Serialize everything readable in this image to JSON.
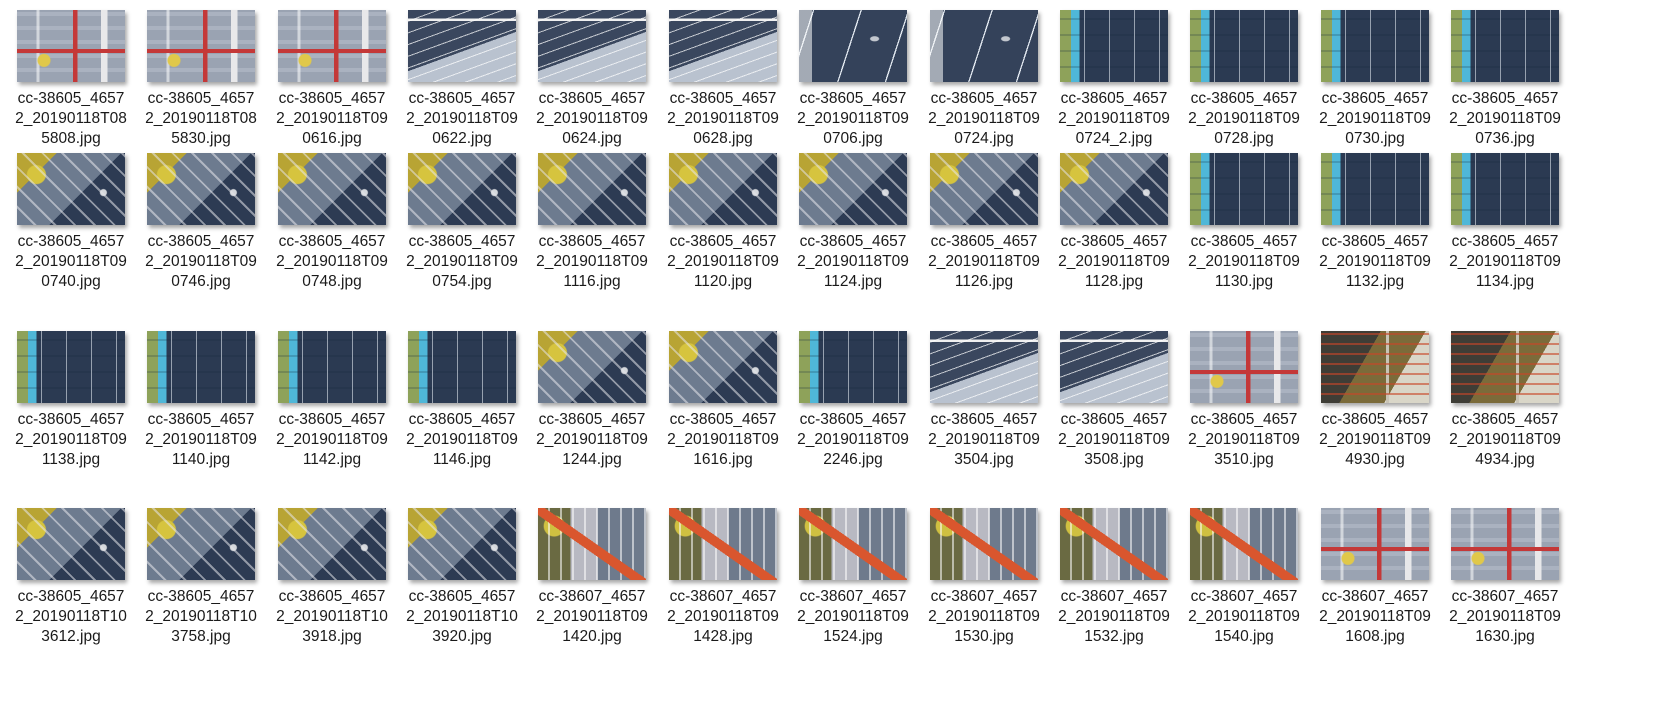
{
  "window": {
    "title": ""
  },
  "files": [
    {
      "name": "cc-38605_46572_20190118T085808.jpg",
      "line1": "cc-38605_4657",
      "line2": "2_20190118T08",
      "line3": "5808.jpg",
      "scene": "site",
      "thumb": "aerial-site-thumbnail"
    },
    {
      "name": "cc-38605_46572_20190118T085830.jpg",
      "line1": "cc-38605_4657",
      "line2": "2_20190118T08",
      "line3": "5830.jpg",
      "scene": "site",
      "thumb": "aerial-site-thumbnail"
    },
    {
      "name": "cc-38605_46572_20190118T090616.jpg",
      "line1": "cc-38605_4657",
      "line2": "2_20190118T09",
      "line3": "0616.jpg",
      "scene": "site",
      "thumb": "aerial-site-thumbnail"
    },
    {
      "name": "cc-38605_46572_20190118T090622.jpg",
      "line1": "cc-38605_4657",
      "line2": "2_20190118T09",
      "line3": "0622.jpg",
      "scene": "viaduct",
      "thumb": "aerial-viaduct-thumbnail"
    },
    {
      "name": "cc-38605_46572_20190118T090624.jpg",
      "line1": "cc-38605_4657",
      "line2": "2_20190118T09",
      "line3": "0624.jpg",
      "scene": "viaduct",
      "thumb": "aerial-viaduct-thumbnail"
    },
    {
      "name": "cc-38605_46572_20190118T090628.jpg",
      "line1": "cc-38605_4657",
      "line2": "2_20190118T09",
      "line3": "0628.jpg",
      "scene": "viaduct",
      "thumb": "aerial-viaduct-thumbnail"
    },
    {
      "name": "cc-38605_46572_20190118T090706.jpg",
      "line1": "cc-38605_4657",
      "line2": "2_20190118T09",
      "line3": "0706.jpg",
      "scene": "road",
      "thumb": "aerial-road-thumbnail"
    },
    {
      "name": "cc-38605_46572_20190118T090724.jpg",
      "line1": "cc-38605_4657",
      "line2": "2_20190118T09",
      "line3": "0724.jpg",
      "scene": "road",
      "thumb": "aerial-road-thumbnail"
    },
    {
      "name": "cc-38605_46572_20190118T090724_2.jpg",
      "line1": "cc-38605_4657",
      "line2": "2_20190118T09",
      "line3": "0724_2.jpg",
      "scene": "bus",
      "thumb": "aerial-road-thumbnail"
    },
    {
      "name": "cc-38605_46572_20190118T090728.jpg",
      "line1": "cc-38605_4657",
      "line2": "2_20190118T09",
      "line3": "0728.jpg",
      "scene": "bus",
      "thumb": "aerial-road-thumbnail"
    },
    {
      "name": "cc-38605_46572_20190118T090730.jpg",
      "line1": "cc-38605_4657",
      "line2": "2_20190118T09",
      "line3": "0730.jpg",
      "scene": "bus",
      "thumb": "aerial-road-thumbnail"
    },
    {
      "name": "cc-38605_46572_20190118T090736.jpg",
      "line1": "cc-38605_4657",
      "line2": "2_20190118T09",
      "line3": "0736.jpg",
      "scene": "bus",
      "thumb": "aerial-road-thumbnail"
    },
    {
      "name": "cc-38605_46572_20190118T090740.jpg",
      "line1": "cc-38605_4657",
      "line2": "2_20190118T09",
      "line3": "0740.jpg",
      "scene": "corner",
      "thumb": "aerial-corner-thumbnail"
    },
    {
      "name": "cc-38605_46572_20190118T090746.jpg",
      "line1": "cc-38605_4657",
      "line2": "2_20190118T09",
      "line3": "0746.jpg",
      "scene": "corner",
      "thumb": "aerial-corner-thumbnail"
    },
    {
      "name": "cc-38605_46572_20190118T090748.jpg",
      "line1": "cc-38605_4657",
      "line2": "2_20190118T09",
      "line3": "0748.jpg",
      "scene": "corner",
      "thumb": "aerial-corner-thumbnail"
    },
    {
      "name": "cc-38605_46572_20190118T090754.jpg",
      "line1": "cc-38605_4657",
      "line2": "2_20190118T09",
      "line3": "0754.jpg",
      "scene": "corner",
      "thumb": "aerial-corner-thumbnail"
    },
    {
      "name": "cc-38605_46572_20190118T091116.jpg",
      "line1": "cc-38605_4657",
      "line2": "2_20190118T09",
      "line3": "1116.jpg",
      "scene": "corner",
      "thumb": "aerial-corner-thumbnail"
    },
    {
      "name": "cc-38605_46572_20190118T091120.jpg",
      "line1": "cc-38605_4657",
      "line2": "2_20190118T09",
      "line3": "1120.jpg",
      "scene": "corner",
      "thumb": "aerial-corner-thumbnail"
    },
    {
      "name": "cc-38605_46572_20190118T091124.jpg",
      "line1": "cc-38605_4657",
      "line2": "2_20190118T09",
      "line3": "1124.jpg",
      "scene": "corner",
      "thumb": "aerial-corner-thumbnail"
    },
    {
      "name": "cc-38605_46572_20190118T091126.jpg",
      "line1": "cc-38605_4657",
      "line2": "2_20190118T09",
      "line3": "1126.jpg",
      "scene": "corner",
      "thumb": "aerial-corner-thumbnail"
    },
    {
      "name": "cc-38605_46572_20190118T091128.jpg",
      "line1": "cc-38605_4657",
      "line2": "2_20190118T09",
      "line3": "1128.jpg",
      "scene": "corner",
      "thumb": "aerial-corner-thumbnail"
    },
    {
      "name": "cc-38605_46572_20190118T091130.jpg",
      "line1": "cc-38605_4657",
      "line2": "2_20190118T09",
      "line3": "1130.jpg",
      "scene": "bus",
      "thumb": "aerial-road-thumbnail"
    },
    {
      "name": "cc-38605_46572_20190118T091132.jpg",
      "line1": "cc-38605_4657",
      "line2": "2_20190118T09",
      "line3": "1132.jpg",
      "scene": "bus",
      "thumb": "aerial-road-thumbnail"
    },
    {
      "name": "cc-38605_46572_20190118T091134.jpg",
      "line1": "cc-38605_4657",
      "line2": "2_20190118T09",
      "line3": "1134.jpg",
      "scene": "bus",
      "thumb": "aerial-road-thumbnail"
    },
    {
      "name": "cc-38605_46572_20190118T091138.jpg",
      "line1": "cc-38605_4657",
      "line2": "2_20190118T09",
      "line3": "1138.jpg",
      "scene": "bus",
      "thumb": "aerial-road-thumbnail"
    },
    {
      "name": "cc-38605_46572_20190118T091140.jpg",
      "line1": "cc-38605_4657",
      "line2": "2_20190118T09",
      "line3": "1140.jpg",
      "scene": "bus",
      "thumb": "aerial-road-thumbnail"
    },
    {
      "name": "cc-38605_46572_20190118T091142.jpg",
      "line1": "cc-38605_4657",
      "line2": "2_20190118T09",
      "line3": "1142.jpg",
      "scene": "bus",
      "thumb": "aerial-road-thumbnail"
    },
    {
      "name": "cc-38605_46572_20190118T091146.jpg",
      "line1": "cc-38605_4657",
      "line2": "2_20190118T09",
      "line3": "1146.jpg",
      "scene": "bus",
      "thumb": "aerial-road-thumbnail"
    },
    {
      "name": "cc-38605_46572_20190118T091244.jpg",
      "line1": "cc-38605_4657",
      "line2": "2_20190118T09",
      "line3": "1244.jpg",
      "scene": "corner",
      "thumb": "aerial-corner-thumbnail"
    },
    {
      "name": "cc-38605_46572_20190118T091616.jpg",
      "line1": "cc-38605_4657",
      "line2": "2_20190118T09",
      "line3": "1616.jpg",
      "scene": "corner",
      "thumb": "aerial-corner-thumbnail"
    },
    {
      "name": "cc-38605_46572_20190118T092246.jpg",
      "line1": "cc-38605_4657",
      "line2": "2_20190118T09",
      "line3": "2246.jpg",
      "scene": "bus",
      "thumb": "aerial-road-thumbnail"
    },
    {
      "name": "cc-38605_46572_20190118T093504.jpg",
      "line1": "cc-38605_4657",
      "line2": "2_20190118T09",
      "line3": "3504.jpg",
      "scene": "viaduct",
      "thumb": "aerial-viaduct-thumbnail"
    },
    {
      "name": "cc-38605_46572_20190118T093508.jpg",
      "line1": "cc-38605_4657",
      "line2": "2_20190118T09",
      "line3": "3508.jpg",
      "scene": "viaduct",
      "thumb": "aerial-viaduct-thumbnail"
    },
    {
      "name": "cc-38605_46572_20190118T093510.jpg",
      "line1": "cc-38605_4657",
      "line2": "2_20190118T09",
      "line3": "3510.jpg",
      "scene": "site",
      "thumb": "aerial-site-thumbnail"
    },
    {
      "name": "cc-38605_46572_20190118T094930.jpg",
      "line1": "cc-38605_4657",
      "line2": "2_20190118T09",
      "line3": "4930.jpg",
      "scene": "dark",
      "thumb": "aerial-crane-thumbnail"
    },
    {
      "name": "cc-38605_46572_20190118T094934.jpg",
      "line1": "cc-38605_4657",
      "line2": "2_20190118T09",
      "line3": "4934.jpg",
      "scene": "dark",
      "thumb": "aerial-crane-thumbnail"
    },
    {
      "name": "cc-38605_46572_20190118T103612.jpg",
      "line1": "cc-38605_4657",
      "line2": "2_20190118T10",
      "line3": "3612.jpg",
      "scene": "corner",
      "thumb": "aerial-corner-thumbnail"
    },
    {
      "name": "cc-38605_46572_20190118T103758.jpg",
      "line1": "cc-38605_4657",
      "line2": "2_20190118T10",
      "line3": "3758.jpg",
      "scene": "corner",
      "thumb": "aerial-corner-thumbnail"
    },
    {
      "name": "cc-38605_46572_20190118T103918.jpg",
      "line1": "cc-38605_4657",
      "line2": "2_20190118T10",
      "line3": "3918.jpg",
      "scene": "corner",
      "thumb": "aerial-corner-thumbnail"
    },
    {
      "name": "cc-38605_46572_20190118T103920.jpg",
      "line1": "cc-38605_4657",
      "line2": "2_20190118T10",
      "line3": "3920.jpg",
      "scene": "corner",
      "thumb": "aerial-corner-thumbnail"
    },
    {
      "name": "cc-38607_46572_20190118T091420.jpg",
      "line1": "cc-38607_4657",
      "line2": "2_20190118T09",
      "line3": "1420.jpg",
      "scene": "crane",
      "thumb": "aerial-crane-thumbnail"
    },
    {
      "name": "cc-38607_46572_20190118T091428.jpg",
      "line1": "cc-38607_4657",
      "line2": "2_20190118T09",
      "line3": "1428.jpg",
      "scene": "crane",
      "thumb": "aerial-crane-thumbnail"
    },
    {
      "name": "cc-38607_46572_20190118T091524.jpg",
      "line1": "cc-38607_4657",
      "line2": "2_20190118T09",
      "line3": "1524.jpg",
      "scene": "crane",
      "thumb": "aerial-crane-thumbnail"
    },
    {
      "name": "cc-38607_46572_20190118T091530.jpg",
      "line1": "cc-38607_4657",
      "line2": "2_20190118T09",
      "line3": "1530.jpg",
      "scene": "crane",
      "thumb": "aerial-crane-thumbnail"
    },
    {
      "name": "cc-38607_46572_20190118T091532.jpg",
      "line1": "cc-38607_4657",
      "line2": "2_20190118T09",
      "line3": "1532.jpg",
      "scene": "crane",
      "thumb": "aerial-crane-thumbnail"
    },
    {
      "name": "cc-38607_46572_20190118T091540.jpg",
      "line1": "cc-38607_4657",
      "line2": "2_20190118T09",
      "line3": "1540.jpg",
      "scene": "crane",
      "thumb": "aerial-crane-thumbnail"
    },
    {
      "name": "cc-38607_46572_20190118T091608.jpg",
      "line1": "cc-38607_4657",
      "line2": "2_20190118T09",
      "line3": "1608.jpg",
      "scene": "site",
      "thumb": "aerial-site-thumbnail"
    },
    {
      "name": "cc-38607_46572_20190118T091630.jpg",
      "line1": "cc-38607_4657",
      "line2": "2_20190118T09",
      "line3": "1630.jpg",
      "scene": "site",
      "thumb": "aerial-site-thumbnail"
    }
  ]
}
